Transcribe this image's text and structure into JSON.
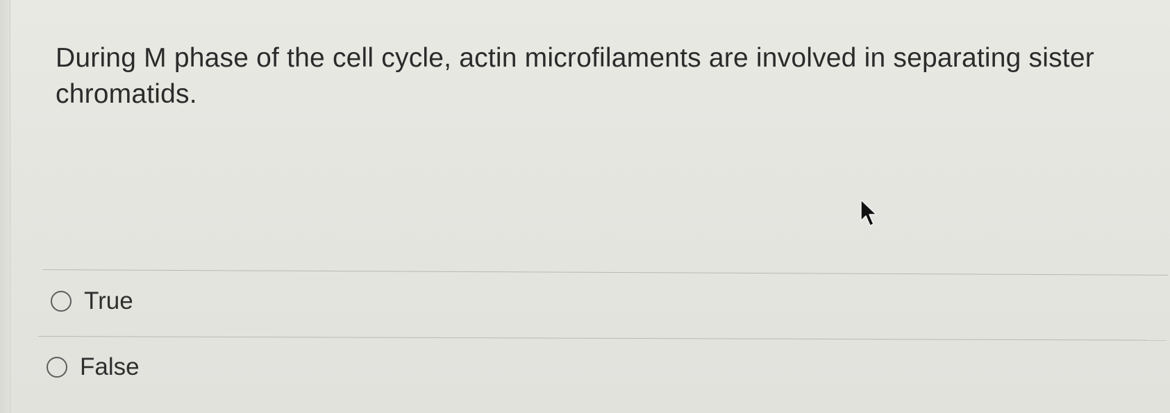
{
  "question": {
    "text": "During M phase of the cell cycle, actin microfilaments are involved in separating sister chromatids."
  },
  "options": [
    {
      "label": "True",
      "selected": false
    },
    {
      "label": "False",
      "selected": false
    }
  ],
  "colors": {
    "background": "#e5e5e0",
    "text": "#2b2b2b",
    "radio_border": "#5d5d5d",
    "divider": "#b9b9b4"
  },
  "icons": {
    "cursor": "arrow-cursor-icon",
    "radio": "radio-button-icon"
  }
}
